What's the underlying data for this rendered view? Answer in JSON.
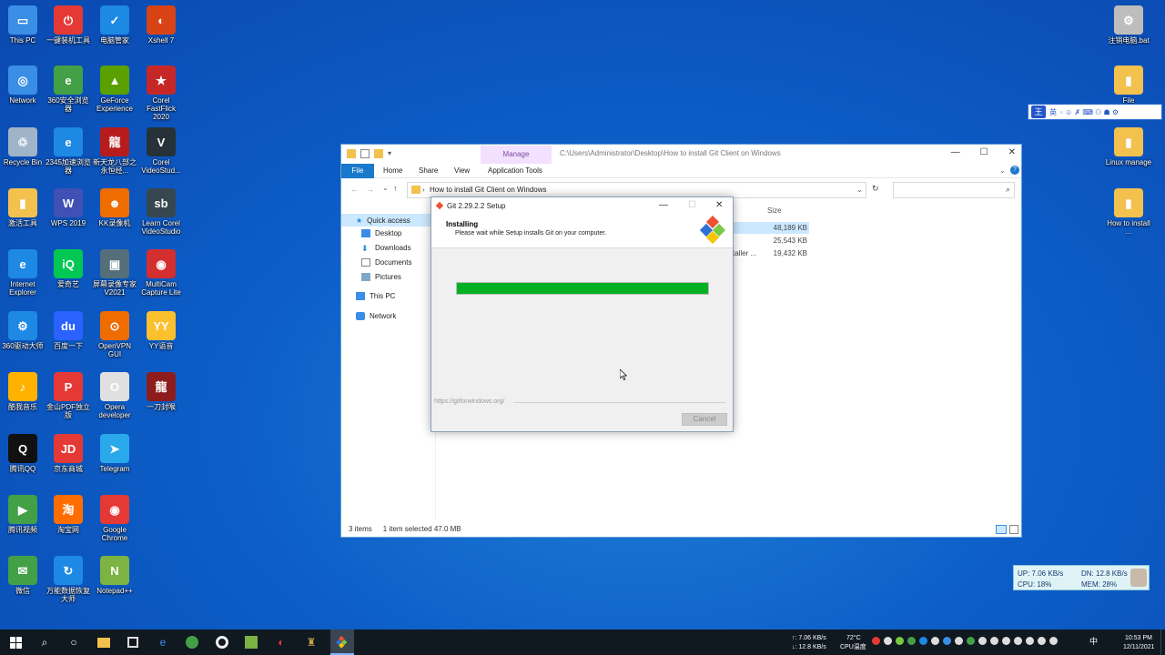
{
  "desktop_icons": [
    {
      "id": "this-pc",
      "label": "This PC",
      "color": "#3a8ee6",
      "glyph": "▭"
    },
    {
      "id": "yijian",
      "label": "一键装机工具",
      "color": "#e53935",
      "glyph": "⏻"
    },
    {
      "id": "diannao-guanjia",
      "label": "电脑管家",
      "color": "#1e88e5",
      "glyph": "✓"
    },
    {
      "id": "xshell",
      "label": "Xshell 7",
      "color": "#d84315",
      "glyph": "◐"
    },
    {
      "id": "network",
      "label": "Network",
      "color": "#3a8ee6",
      "glyph": "◎"
    },
    {
      "id": "360-browser",
      "label": "360安全浏览器",
      "color": "#43a047",
      "glyph": "e"
    },
    {
      "id": "geforce",
      "label": "GeForce Experience",
      "color": "#5aa000",
      "glyph": "▲"
    },
    {
      "id": "corel-fastflick",
      "label": "Corel FastFlick 2020",
      "color": "#c62828",
      "glyph": "★"
    },
    {
      "id": "recycle-bin",
      "label": "Recycle Bin",
      "color": "#9fb4c8",
      "glyph": "♲"
    },
    {
      "id": "2345",
      "label": "2345加速浏览器",
      "color": "#1e88e5",
      "glyph": "e"
    },
    {
      "id": "tianlong",
      "label": "新天龙八部之永恒经...",
      "color": "#b71c1c",
      "glyph": "龍"
    },
    {
      "id": "corel-videostudio",
      "label": "Corel VideoStud...",
      "color": "#263238",
      "glyph": "V"
    },
    {
      "id": "jihuo",
      "label": "激活工具",
      "color": "#f2c14e",
      "glyph": "▮"
    },
    {
      "id": "wps",
      "label": "WPS 2019",
      "color": "#3f51b5",
      "glyph": "W"
    },
    {
      "id": "kk",
      "label": "KK录像机",
      "color": "#ef6c00",
      "glyph": "☻"
    },
    {
      "id": "learn-corel",
      "label": "Learn Corel VideoStudio",
      "color": "#37474f",
      "glyph": "sb"
    },
    {
      "id": "ie",
      "label": "Internet Explorer",
      "color": "#1e88e5",
      "glyph": "e"
    },
    {
      "id": "iqiyi",
      "label": "爱奇艺",
      "color": "#00c853",
      "glyph": "iQ"
    },
    {
      "id": "pingmu",
      "label": "屏幕录像专家V2021",
      "color": "#546e7a",
      "glyph": "▣"
    },
    {
      "id": "multicam",
      "label": "MultiCam Capture Lite",
      "color": "#d32f2f",
      "glyph": "◉"
    },
    {
      "id": "360-driver",
      "label": "360驱动大师",
      "color": "#1e88e5",
      "glyph": "⚙"
    },
    {
      "id": "baidu",
      "label": "百度一下",
      "color": "#2962ff",
      "glyph": "du"
    },
    {
      "id": "openvpn",
      "label": "OpenVPN GUI",
      "color": "#ef6c00",
      "glyph": "⊙"
    },
    {
      "id": "yy",
      "label": "YY语音",
      "color": "#fbc02d",
      "glyph": "YY"
    },
    {
      "id": "kugou",
      "label": "酷我音乐",
      "color": "#ffb300",
      "glyph": "♪"
    },
    {
      "id": "jinshan-pdf",
      "label": "金山PDF独立版",
      "color": "#e53935",
      "glyph": "P"
    },
    {
      "id": "opera-dev",
      "label": "Opera developer",
      "color": "#e0e0e0",
      "glyph": "O"
    },
    {
      "id": "tianlong-2",
      "label": "一刀封喉",
      "color": "#8d1c1c",
      "glyph": "龍"
    },
    {
      "id": "qq",
      "label": "腾讯QQ",
      "color": "#111111",
      "glyph": "Q"
    },
    {
      "id": "jd",
      "label": "京东商城",
      "color": "#e53935",
      "glyph": "JD"
    },
    {
      "id": "telegram",
      "label": "Telegram",
      "color": "#29a9eb",
      "glyph": "➤"
    },
    {
      "id": "tencent-video",
      "label": "腾讯视频",
      "color": "#43a047",
      "glyph": "▶"
    },
    {
      "id": "taobao",
      "label": "淘宝网",
      "color": "#ff6d00",
      "glyph": "淘"
    },
    {
      "id": "chrome",
      "label": "Google Chrome",
      "color": "#e53935",
      "glyph": "◉"
    },
    {
      "id": "wechat",
      "label": "微信",
      "color": "#43a047",
      "glyph": "✉"
    },
    {
      "id": "data-recovery",
      "label": "万能数据恢复大师",
      "color": "#1e88e5",
      "glyph": "↻"
    },
    {
      "id": "notepadpp",
      "label": "Notepad++",
      "color": "#7cb342",
      "glyph": "N"
    },
    {
      "id": "zhuxiao",
      "label": "注销电脑.bat",
      "color": "#bdbdbd",
      "glyph": "⚙"
    },
    {
      "id": "file",
      "label": "File",
      "color": "#f2c14e",
      "glyph": "▮"
    },
    {
      "id": "linux-manage",
      "label": "Linux manage",
      "color": "#f2c14e",
      "glyph": "▮"
    },
    {
      "id": "how-to",
      "label": "How to install ...",
      "color": "#f2c14e",
      "glyph": "▮"
    }
  ],
  "ime_bar": {
    "mode": "王",
    "lang": "英",
    "extras": "◦ ☺ ✗ ⌨ ⚇ ☗ ⚙"
  },
  "explorer": {
    "manage_tab": "Manage",
    "path_title": "C:\\Users\\Administrator\\Desktop\\How to install Git Client on Windows",
    "ribbon_tabs": {
      "file": "File",
      "home": "Home",
      "share": "Share",
      "view": "View",
      "app_tools": "Application Tools"
    },
    "address": "How to install Git Client on Windows",
    "nav": {
      "quick_access": "Quick access",
      "desktop": "Desktop",
      "downloads": "Downloads",
      "documents": "Documents",
      "pictures": "Pictures",
      "this_pc": "This PC",
      "network": "Network"
    },
    "column_size": "Size",
    "files": [
      {
        "name_tail": "",
        "size": "48,189 KB"
      },
      {
        "name_tail": "",
        "size": "25,543 KB"
      },
      {
        "name_tail": "taller ...",
        "size": "19,432 KB"
      }
    ],
    "status": {
      "items": "3 items",
      "selected": "1 item selected  47.0 MB"
    }
  },
  "setup": {
    "title": "Git 2.29.2.2 Setup",
    "heading": "Installing",
    "subheading": "Please wait while Setup installs Git on your computer.",
    "progress": 1.0,
    "url": "https://gitforwindows.org/",
    "cancel": "Cancel"
  },
  "netmon": {
    "up": "UP: 7.06 KB/s",
    "dn": "DN: 12.8 KB/s",
    "cpu": "CPU: 18%",
    "mem": "MEM: 28%"
  },
  "taskbar": {
    "net_up": "↑: 7.06 KB/s",
    "net_dn": "↓: 12.8 KB/s",
    "temp": "72°C",
    "temp_label": "CPU温度",
    "ime": "中",
    "time": "10:53 PM",
    "date": "12/11/2021"
  }
}
